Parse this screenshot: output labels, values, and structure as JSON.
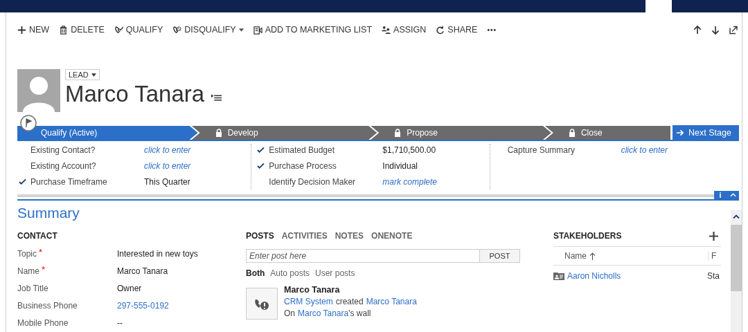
{
  "commands": [
    {
      "label": "NEW",
      "kind": "plus",
      "dropdown": false
    },
    {
      "label": "DELETE",
      "kind": "trash",
      "dropdown": false
    },
    {
      "label": "QUALIFY",
      "kind": "phone-check",
      "dropdown": false
    },
    {
      "label": "DISQUALIFY",
      "kind": "phone-ban",
      "dropdown": true
    },
    {
      "label": "ADD TO MARKETING LIST",
      "kind": "list",
      "dropdown": false
    },
    {
      "label": "ASSIGN",
      "kind": "people",
      "dropdown": false
    },
    {
      "label": "SHARE",
      "kind": "share",
      "dropdown": false
    },
    {
      "label": "•••",
      "kind": "more",
      "dropdown": false
    }
  ],
  "record": {
    "entity": "LEAD",
    "name": "Marco Tanara"
  },
  "process": {
    "stages": [
      {
        "label": "Qualify (Active)",
        "selected": true,
        "locked": false
      },
      {
        "label": "Develop",
        "selected": false,
        "locked": true
      },
      {
        "label": "Propose",
        "selected": false,
        "locked": true
      },
      {
        "label": "Close",
        "selected": false,
        "locked": true
      }
    ],
    "next_button": "Next Stage",
    "columns": [
      [
        {
          "label": "Existing Contact?",
          "checked": false,
          "value": "click to enter",
          "kind": "link"
        },
        {
          "label": "Existing Account?",
          "checked": false,
          "value": "click to enter",
          "kind": "link"
        },
        {
          "label": "Purchase Timeframe",
          "checked": true,
          "value": "This Quarter",
          "kind": "text"
        }
      ],
      [
        {
          "label": "Estimated Budget",
          "checked": true,
          "value": "$1,710,500.00",
          "kind": "text"
        },
        {
          "label": "Purchase Process",
          "checked": true,
          "value": "Individual",
          "kind": "text"
        },
        {
          "label": "Identify Decision Maker",
          "checked": false,
          "value": "mark complete",
          "kind": "link"
        }
      ],
      [
        {
          "label": "Capture Summary",
          "checked": false,
          "value": "click to enter",
          "kind": "link"
        }
      ]
    ],
    "info_button": "i"
  },
  "summary": {
    "title": "Summary",
    "contact": {
      "heading": "CONTACT",
      "required_mark": "*",
      "fields": [
        {
          "label": "Topic",
          "required": true,
          "value": "Interested in new toys",
          "kind": "text"
        },
        {
          "label": "Name",
          "required": true,
          "value": "Marco Tanara",
          "kind": "text"
        },
        {
          "label": "Job Title",
          "required": false,
          "value": "Owner",
          "kind": "text"
        },
        {
          "label": "Business Phone",
          "required": false,
          "value": "297-555-0192",
          "kind": "link"
        },
        {
          "label": "Mobile Phone",
          "required": false,
          "value": "--",
          "kind": "text"
        }
      ]
    },
    "social": {
      "tabs": [
        {
          "label": "POSTS",
          "selected": true
        },
        {
          "label": "ACTIVITIES",
          "selected": false
        },
        {
          "label": "NOTES",
          "selected": false
        },
        {
          "label": "ONENOTE",
          "selected": false
        }
      ],
      "post_placeholder": "Enter post here",
      "post_button": "POST",
      "filters": [
        {
          "label": "Both",
          "selected": true
        },
        {
          "label": "Auto posts",
          "selected": false
        },
        {
          "label": "User posts",
          "selected": false
        }
      ],
      "post": {
        "author": "Marco Tanara",
        "lines": [
          [
            {
              "text": "CRM System",
              "link": true
            },
            {
              "text": "created",
              "link": false
            },
            {
              "text": "Marco Tanara",
              "link": true
            }
          ],
          [
            {
              "text": "On",
              "link": false
            },
            {
              "text": "Marco Tanara",
              "link": true
            },
            {
              "text": "'s wall",
              "link": false
            }
          ]
        ]
      }
    },
    "stakeholders": {
      "heading": "STAKEHOLDERS",
      "columns": [
        "Name",
        "F"
      ],
      "rows": [
        {
          "name": "Aaron Nicholls",
          "column_2": "Sta"
        }
      ]
    }
  }
}
